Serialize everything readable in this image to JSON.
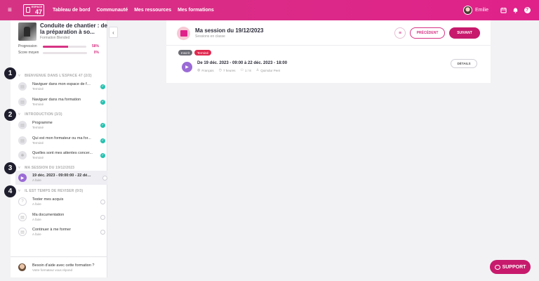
{
  "topbar": {
    "logo_small": "ESPACE",
    "logo_num": "47",
    "nav": [
      "Tableau de bord",
      "Communauté",
      "Mes ressources",
      "Mes formations"
    ],
    "user_name": "Emilie",
    "help_glyph": "?"
  },
  "sidebar": {
    "course_title": "Conduite de chantier : de la préparation à so...",
    "course_sub": "Formation Blended",
    "progress_label": "Progression",
    "progress_value": "58%",
    "progress_fraction": 0.58,
    "score_label": "Score moyen",
    "score_value": "0%",
    "score_fraction": 0,
    "sections": [
      {
        "title": "BIENVENUE DANS L'ESPACE 47 (2/2)",
        "items": [
          {
            "title": "Naviguer dans mon espace de for...",
            "status": "Terminé",
            "done": true
          },
          {
            "title": "Naviguer dans ma formation",
            "status": "Terminé",
            "done": true
          }
        ]
      },
      {
        "title": "INTRODUCTION (3/3)",
        "items": [
          {
            "title": "Programme",
            "status": "Terminé",
            "done": true
          },
          {
            "title": "Qui est mon formateur ou ma for...",
            "status": "Terminé",
            "done": true
          },
          {
            "title": "Quelles sont mes attentes concer...",
            "status": "Terminé",
            "done": true
          }
        ]
      },
      {
        "title": "MA SESSION DU 19/12/2023",
        "items": [
          {
            "title": "19 déc. 2023 - 09:00:00 - 22 déc. 2...",
            "status": "A faire",
            "done": false
          }
        ]
      },
      {
        "title": "IL EST TEMPS DE REVISER (0/3)",
        "items": [
          {
            "title": "Tester mes acquis",
            "status": "A faire",
            "done": false
          },
          {
            "title": "Ma documentation",
            "status": "A faire",
            "done": false
          },
          {
            "title": "Continuer à me former",
            "status": "A faire",
            "done": false
          }
        ]
      }
    ],
    "help_title": "Besoin d'aide avec cette formation ?",
    "help_sub": "Votre formateur vous répond"
  },
  "steps": [
    "1",
    "2",
    "3",
    "4"
  ],
  "session": {
    "title": "Ma session du 19/12/2023",
    "sub": "Sessions en classe",
    "prev_label": "PRÉCÉDENT",
    "next_label": "SUIVANT",
    "tags": [
      "Inscrit",
      "Terminé"
    ],
    "event_title": "De 19 déc. 2023 - 09:00 à 22 déc. 2023 - 18:00",
    "meta": [
      "Français",
      "7 heures",
      "1 / 8",
      "Quimdur Peet"
    ],
    "details_label": "DÉTAILS"
  },
  "support_label": "SUPPORT",
  "colors": {
    "brand": "#d63384",
    "done": "#27c2b0",
    "video": "#9b6bd6"
  }
}
